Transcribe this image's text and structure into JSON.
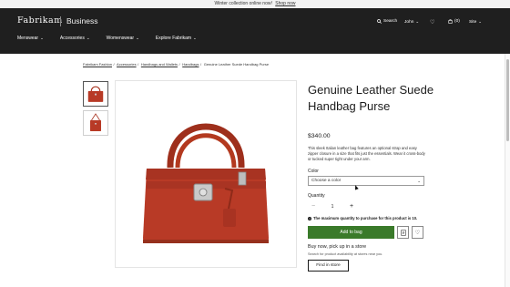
{
  "promo": {
    "text": "Winter collection online now!",
    "link": "Shop now"
  },
  "header": {
    "brand": "Fabrikam",
    "brand_sub": "Business",
    "search": "Search",
    "user": "John",
    "cart_count": "(0)",
    "site": "Site",
    "nav": [
      "Menswear",
      "Accessories",
      "Womenswear",
      "Explore Fabrikam"
    ]
  },
  "breadcrumb": [
    "Fabrikam Fashion",
    "Accessories",
    "Handbags and Wallets",
    "Handbags",
    "Genuine Leather Suede Handbag Purse"
  ],
  "product": {
    "title": "Genuine Leather Suede Handbag Purse",
    "price": "$340.00",
    "description": "This sleek Italian leather bag features an optional strap and easy zipper closure in a size that fits just the essentials. Wear it cross-body or tucked super tight under your arm.",
    "color_label": "Color",
    "color_placeholder": "Choose a color",
    "quantity_label": "Quantity",
    "quantity_value": "1",
    "minus": "−",
    "plus": "+",
    "max_note": "The maximum quantity to purchase for this product is 10.",
    "add_to_bag": "Add to bag",
    "pickup_title": "Buy now, pick up in a store",
    "pickup_sub": "Search for product availability at stores near you.",
    "find_store": "Find in store"
  },
  "colors": {
    "header_bg": "#1f1f1f",
    "add_to_bag": "#3a7a2a",
    "bag": "#b83a26"
  },
  "icons": [
    "search-icon",
    "user-icon",
    "heart-icon",
    "bag-icon",
    "chevron-down-icon",
    "info-icon",
    "document-icon"
  ]
}
